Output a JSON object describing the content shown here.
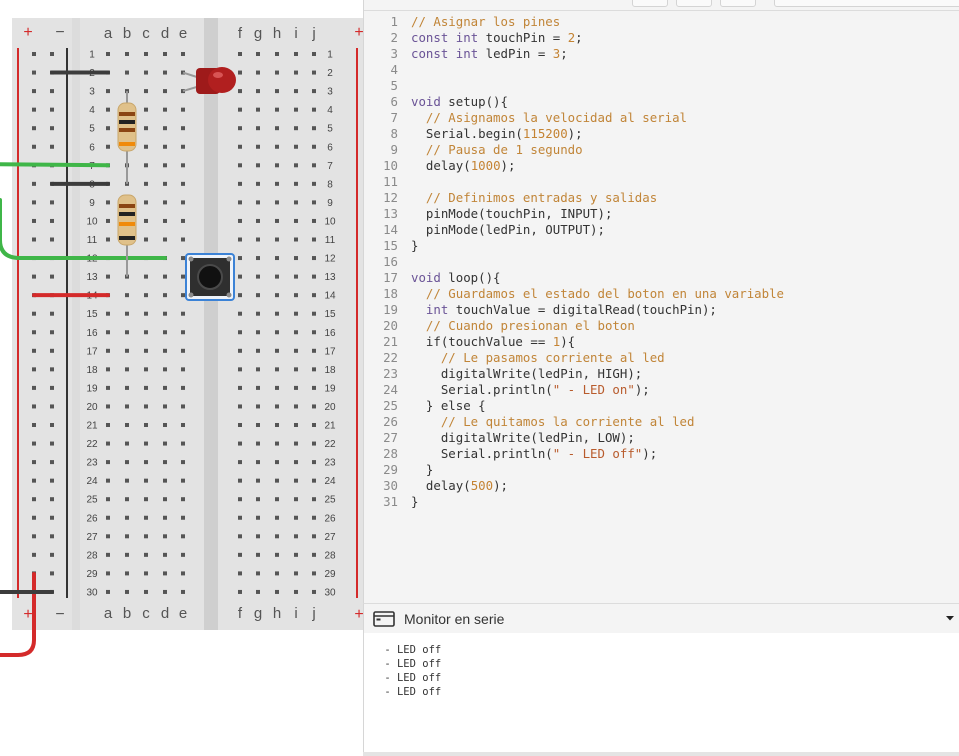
{
  "breadboard": {
    "top_rail_plus": "+",
    "top_rail_minus": "−",
    "bottom_rail_plus": "+",
    "bottom_rail_minus": "−",
    "columns_left": [
      "a",
      "b",
      "c",
      "d",
      "e"
    ],
    "columns_right": [
      "f",
      "g",
      "h",
      "i",
      "j"
    ],
    "row_count": 30,
    "wire_colors": {
      "green": "#3fb648",
      "red": "#d42a2a",
      "black": "#3c3c3c"
    }
  },
  "code_editor": {
    "lines": [
      "// Asignar los pines",
      "const int touchPin = 2;",
      "const int ledPin = 3;",
      "",
      "",
      "void setup(){",
      "  // Asignamos la velocidad al serial",
      "  Serial.begin(115200);",
      "  // Pausa de 1 segundo",
      "  delay(1000);",
      "",
      "  // Definimos entradas y salidas",
      "  pinMode(touchPin, INPUT);",
      "  pinMode(ledPin, OUTPUT);",
      "}",
      "",
      "void loop(){",
      "  // Guardamos el estado del boton en una variable",
      "  int touchValue = digitalRead(touchPin);",
      "  // Cuando presionan el boton",
      "  if(touchValue == 1){",
      "    // Le pasamos corriente al led",
      "    digitalWrite(ledPin, HIGH);",
      "    Serial.println(\" - LED on\");",
      "  } else {",
      "    // Le quitamos la corriente al led",
      "    digitalWrite(ledPin, LOW);",
      "    Serial.println(\" - LED off\");",
      "  }",
      "  delay(500);",
      "}"
    ]
  },
  "serial_monitor": {
    "title": "Monitor en serie",
    "icon": "monitor-window-icon",
    "toggle_icon": "chevron-down-icon",
    "output": [
      " - LED off",
      " - LED off",
      " - LED off",
      " - LED off"
    ]
  }
}
